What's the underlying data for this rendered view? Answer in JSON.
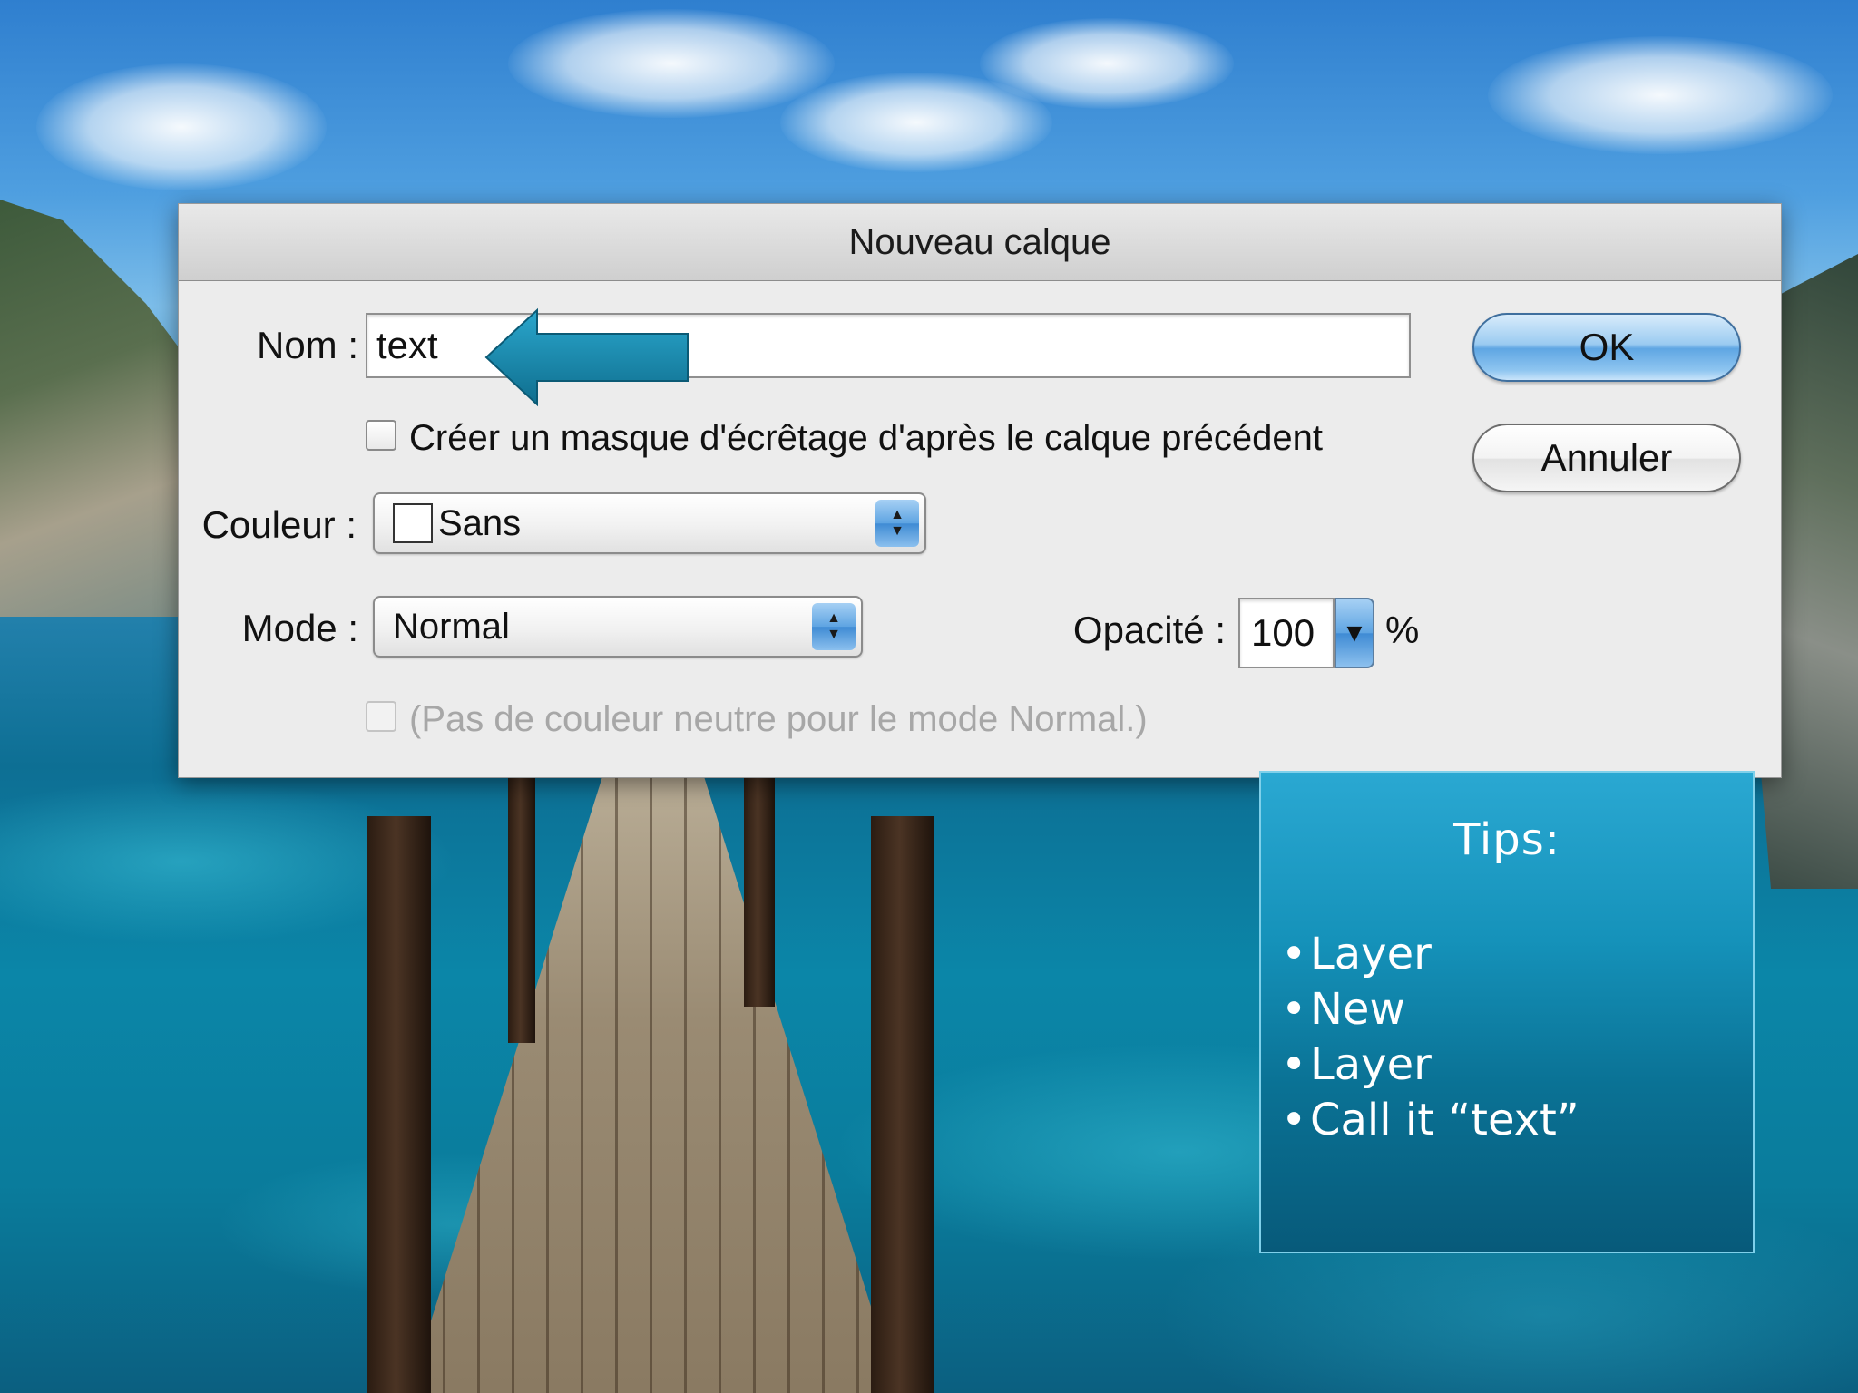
{
  "dialog": {
    "title": "Nouveau calque",
    "name_label": "Nom :",
    "name_value": "text",
    "clip_mask_label": "Créer un masque d'écrêtage d'après le calque précédent",
    "color_label": "Couleur :",
    "color_value": "Sans",
    "mode_label": "Mode :",
    "mode_value": "Normal",
    "opacity_label": "Opacité :",
    "opacity_value": "100",
    "opacity_unit": "%",
    "neutral_color_label": "(Pas de couleur neutre pour le mode Normal.)",
    "ok_label": "OK",
    "cancel_label": "Annuler"
  },
  "tips": {
    "title": "Tips:",
    "items": [
      "Layer",
      "New",
      "Layer",
      "Call it “text”"
    ]
  },
  "colors": {
    "annotation_arrow": "#1e87a8",
    "tips_box": "#1592ba",
    "default_button": "#5fa6e3"
  },
  "icons": [
    "arrow-left-icon",
    "chevron-updown-icon",
    "chevron-down-icon"
  ]
}
